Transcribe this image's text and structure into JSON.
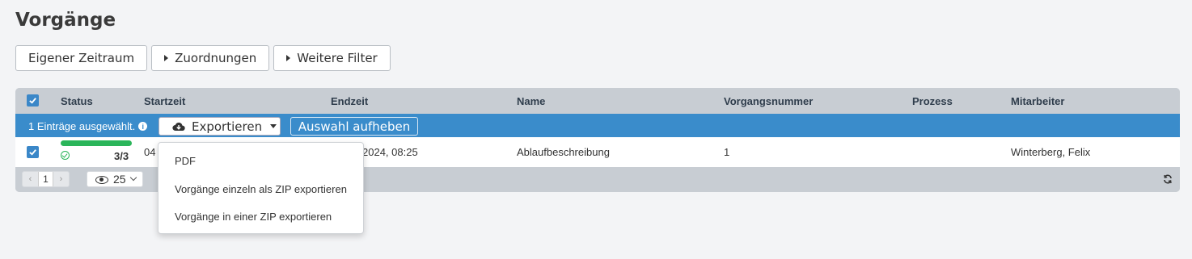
{
  "page": {
    "title": "Vorgänge"
  },
  "filters": [
    {
      "label": "Eigener Zeitraum",
      "caret": false
    },
    {
      "label": "Zuordnungen",
      "caret": true
    },
    {
      "label": "Weitere Filter",
      "caret": true
    }
  ],
  "table": {
    "columns": [
      "Status",
      "Startzeit",
      "Endzeit",
      "Name",
      "Vorgangsnummer",
      "Prozess",
      "Mitarbeiter"
    ],
    "selection": {
      "text": "1 Einträge ausgewählt.",
      "export_label": "Exportieren",
      "clear_label": "Auswahl aufheben"
    },
    "rows": [
      {
        "checked": true,
        "progress": 1.0,
        "count": "3/3",
        "startzeit": "04",
        "endzeit": "2024, 08:25",
        "name": "Ablaufbeschreibung",
        "vorgangsnummer": "1",
        "prozess": "",
        "mitarbeiter": "Winterberg, Felix"
      }
    ],
    "footer": {
      "page": "1",
      "page_size": "25"
    }
  },
  "export_menu": [
    "PDF",
    "Vorgänge einzeln als ZIP exportieren",
    "Vorgänge in einer ZIP exportieren"
  ],
  "colors": {
    "accent": "#3a8ccb",
    "success": "#2bb55a",
    "header_bg": "#c8cdd3"
  },
  "icons": [
    "info-icon",
    "cloud-download-icon",
    "caret-down-icon",
    "caret-right-icon",
    "check-circle-icon",
    "eye-icon",
    "refresh-icon"
  ]
}
